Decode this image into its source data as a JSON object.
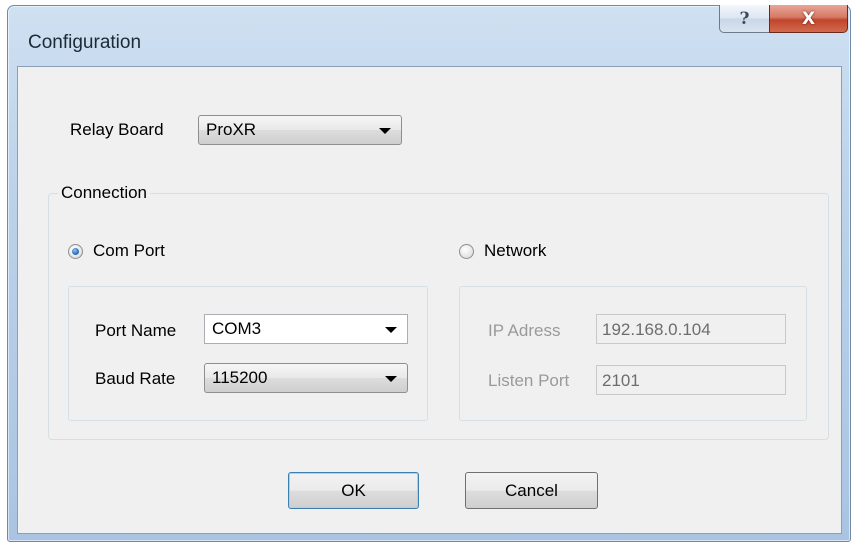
{
  "window": {
    "title": "Configuration",
    "help_glyph": "?",
    "close_glyph": "X"
  },
  "relay_board": {
    "label": "Relay Board",
    "selected": "ProXR"
  },
  "connection": {
    "group_label": "Connection",
    "com_port": {
      "label": "Com Port",
      "selected": true,
      "port_name_label": "Port Name",
      "port_name_value": "COM3",
      "baud_rate_label": "Baud Rate",
      "baud_rate_value": "115200"
    },
    "network": {
      "label": "Network",
      "selected": false,
      "ip_label": "IP Adress",
      "ip_value": "192.168.0.104",
      "listen_port_label": "Listen Port",
      "listen_port_value": "2101"
    }
  },
  "buttons": {
    "ok": "OK",
    "cancel": "Cancel"
  },
  "colors": {
    "title_bar": "#bcd2ea",
    "client_bg": "#f0f0f0",
    "close_button": "#c0452b",
    "radio_selected": "#2a6fb8"
  },
  "icons": {
    "help": "help-icon",
    "close": "close-icon",
    "dropdown": "chevron-down-icon"
  }
}
